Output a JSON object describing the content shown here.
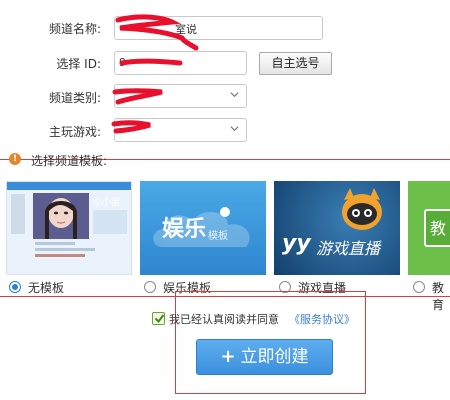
{
  "form": {
    "channel_name_label": "频道名称:",
    "channel_name_value_suffix": "室说",
    "select_id_label": "选择 ID:",
    "select_id_value_prefix": "9",
    "pick_id_button": "自主选号",
    "category_label": "频道类别:",
    "game_label": "主玩游戏:"
  },
  "templates": {
    "section_title": "选择频道模板:",
    "items": [
      {
        "label": "无模板",
        "selected": true,
        "thumb_text": "小小蛋"
      },
      {
        "label": "娱乐模板",
        "selected": false,
        "thumb_text": "娱乐",
        "thumb_sub": "模板"
      },
      {
        "label": "游戏直播",
        "selected": false,
        "thumb_text": "游戏直播",
        "thumb_brand": "yy"
      },
      {
        "label": "教育",
        "selected": false,
        "thumb_text": "教"
      }
    ]
  },
  "agreement": {
    "checked": true,
    "text": "我已经认真阅读并同意",
    "link": "《服务协议》"
  },
  "create_button": {
    "label": "立即创建",
    "icon": "plus-icon"
  },
  "colors": {
    "accent_blue": "#3b8fdc",
    "link_blue": "#3a7fd0",
    "annotation_red": "#d43f3f",
    "scribble_red": "#e8112d",
    "warning_orange": "#e2872b"
  }
}
